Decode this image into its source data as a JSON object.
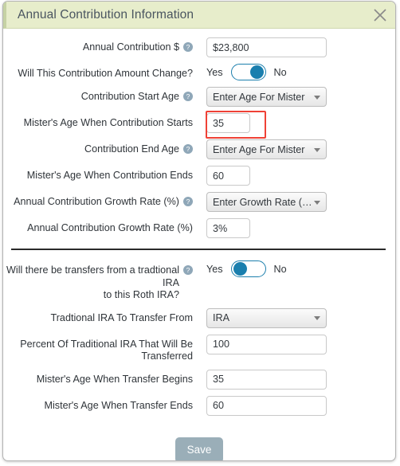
{
  "dialog": {
    "title": "Annual Contribution Information",
    "close_label": "close",
    "header_color": "#e7edcb",
    "accent_color": "#1a7fae",
    "annotation_color": "#ef4136"
  },
  "form": {
    "rows": [
      {
        "label": "Annual Contribution $",
        "help": true,
        "type": "text",
        "size": "wide",
        "value": "$23,800"
      },
      {
        "label": "Will This Contribution Amount Change?",
        "help": false,
        "type": "toggle",
        "yes_label": "Yes",
        "no_label": "No",
        "knob": "right"
      },
      {
        "label": "Contribution Start Age",
        "help": true,
        "type": "select",
        "size": "wide",
        "value": "Enter Age For Mister"
      },
      {
        "label": "Mister's Age When Contribution Starts",
        "help": false,
        "type": "text",
        "size": "narrow",
        "value": "35",
        "annotated": true
      },
      {
        "label": "Contribution End Age",
        "help": true,
        "type": "select",
        "size": "wide",
        "value": "Enter Age For Mister"
      },
      {
        "label": "Mister's Age When Contribution Ends",
        "help": false,
        "type": "text",
        "size": "narrow",
        "value": "60"
      },
      {
        "label": "Annual Contribution Growth Rate (%)",
        "help": true,
        "type": "select",
        "size": "wide",
        "value": "Enter Growth Rate (…"
      },
      {
        "label": "Annual Contribution Growth Rate (%)",
        "help": false,
        "type": "text",
        "size": "narrow",
        "value": "3%"
      }
    ],
    "rows2": [
      {
        "label": "Will there be transfers from a tradtional IRA\nto this Roth IRA?",
        "help": true,
        "type": "toggle",
        "yes_label": "Yes",
        "no_label": "No",
        "knob": "left"
      },
      {
        "label": "Tradtional IRA To Transfer From",
        "help": false,
        "type": "select",
        "size": "wide",
        "value": "IRA"
      },
      {
        "label": "Percent Of Traditional IRA That Will Be\nTransferred",
        "help": false,
        "type": "text",
        "size": "wide",
        "value": "100"
      },
      {
        "label": "Mister's Age When Transfer Begins",
        "help": false,
        "type": "text",
        "size": "wide",
        "value": "35"
      },
      {
        "label": "Mister's Age When Transfer Ends",
        "help": false,
        "type": "text",
        "size": "wide",
        "value": "60"
      }
    ]
  },
  "footer": {
    "save_label": "Save"
  }
}
